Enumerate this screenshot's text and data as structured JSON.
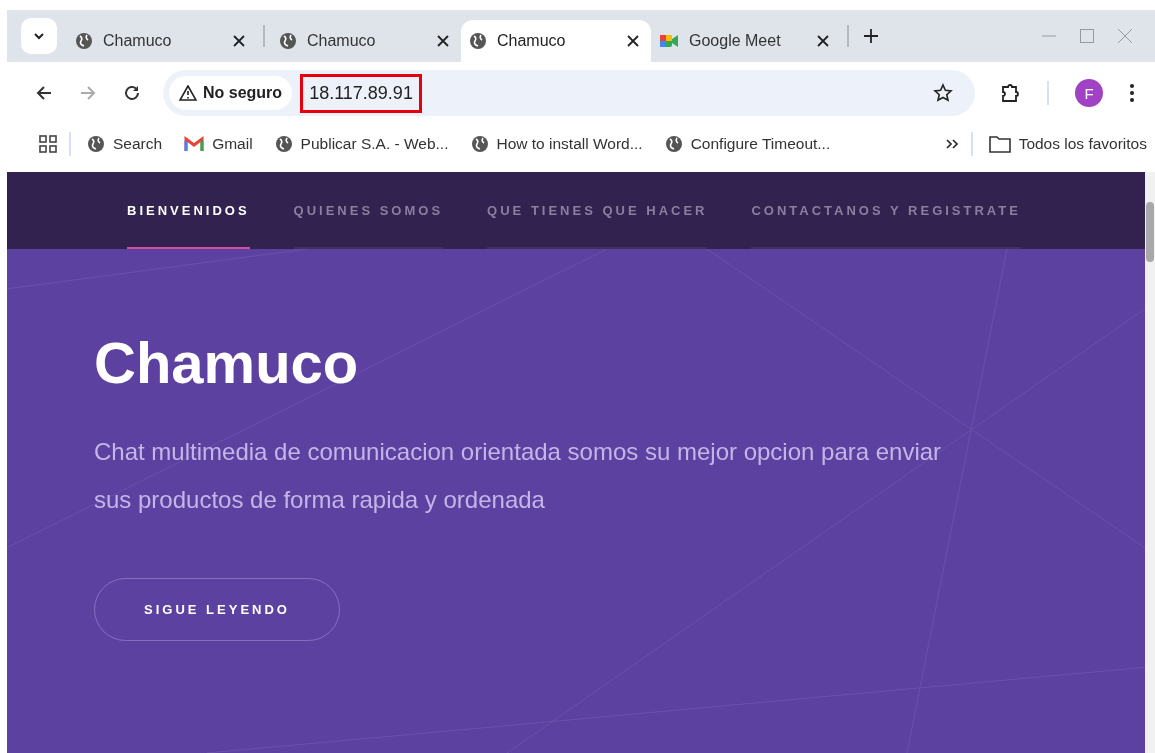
{
  "tabs": [
    {
      "title": "Chamuco",
      "kind": "globe",
      "selected": false
    },
    {
      "title": "Chamuco",
      "kind": "globe",
      "selected": false
    },
    {
      "title": "Chamuco",
      "kind": "globe",
      "selected": true
    },
    {
      "title": "Google Meet",
      "kind": "video",
      "selected": false
    }
  ],
  "address": {
    "security": "No seguro",
    "url": "18.117.89.91",
    "highlighted": true
  },
  "profile": {
    "initial": "F"
  },
  "bookmarks": [
    {
      "label": "Search",
      "kind": "globe"
    },
    {
      "label": "Gmail",
      "kind": "mail"
    },
    {
      "label": "Publicar S.A. - Web...",
      "kind": "globe"
    },
    {
      "label": "How to install Word...",
      "kind": "globe"
    },
    {
      "label": "Configure Timeout...",
      "kind": "globe"
    }
  ],
  "all_bookmarks": "Todos los favoritos",
  "site": {
    "nav": [
      {
        "label": "BIENVENIDOS",
        "selected": true
      },
      {
        "label": "QUIENES SOMOS",
        "selected": false
      },
      {
        "label": "QUE TIENES QUE HACER",
        "selected": false
      },
      {
        "label": "CONTACTANOS Y REGISTRATE",
        "selected": false
      }
    ],
    "title": "Chamuco",
    "subtitle": "Chat multimedia de comunicacion orientada somos su mejor opcion para enviar sus productos de forma rapida y ordenada",
    "button": "SIGUE LEYENDO"
  }
}
